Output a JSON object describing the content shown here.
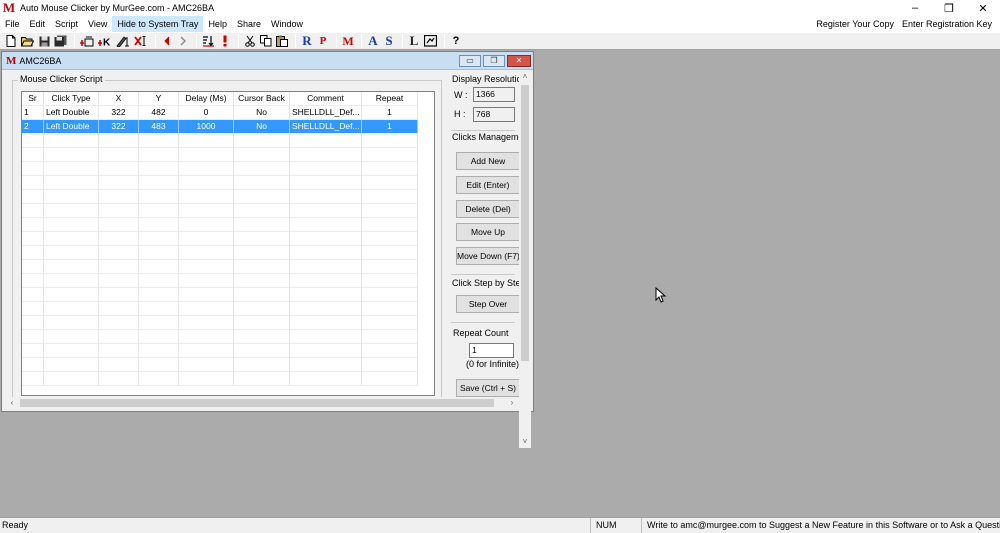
{
  "app": {
    "title": "Auto Mouse Clicker by MurGee.com - AMC26BA",
    "logo_letter": "M",
    "window_controls": [
      "–",
      "❐",
      "✕"
    ]
  },
  "menu": {
    "items": [
      "File",
      "Edit",
      "Script",
      "View",
      "Hide to System Tray",
      "Help",
      "Share",
      "Window"
    ],
    "right_items": [
      "Register Your Copy",
      "Enter Registration Key"
    ]
  },
  "toolbar": {
    "icon_names": [
      "new-file-icon",
      "open-folder-icon",
      "save-icon",
      "save-all-icon",
      "add-click-icon",
      "add-key-icon",
      "edit-icon",
      "delete-icon",
      "previous-icon",
      "next-icon",
      "sort-icon",
      "alert-icon",
      "cut-icon",
      "copy-icon",
      "paste-icon",
      "r-icon",
      "p-icon",
      "m-icon",
      "a-icon",
      "s-icon",
      "l-icon",
      "screen-icon",
      "help-icon"
    ],
    "glyphs": {
      "r": "R",
      "p": "P",
      "m": "M",
      "a": "A",
      "s": "S",
      "l": "L",
      "help": "?"
    },
    "colors": {
      "red": "#d00000",
      "blue": "#1a3ab5"
    }
  },
  "child": {
    "title": "AMC26BA",
    "logo_letter": "M",
    "controls": [
      "▭",
      "❐",
      "✕"
    ],
    "script_group_label": "Mouse Clicker Script",
    "table": {
      "columns": [
        "Sr",
        "Click Type",
        "X",
        "Y",
        "Delay (Ms)",
        "Cursor Back",
        "Comment",
        "Repeat"
      ],
      "rows": [
        [
          "1",
          "Left Double",
          "322",
          "482",
          "0",
          "No",
          "SHELLDLL_Def...",
          "1"
        ],
        [
          "2",
          "Left Double",
          "322",
          "483",
          "1000",
          "No",
          "SHELLDLL_Def...",
          "1"
        ]
      ],
      "selected_row": 1
    },
    "display_resolution": {
      "label": "Display Resolution",
      "w_label": "W :",
      "w_value": "1366",
      "h_label": "H :",
      "h_value": "768"
    },
    "clicks_management": {
      "label": "Clicks Managemen",
      "buttons": [
        "Add New",
        "Edit (Enter)",
        "Delete (Del)",
        "Move Up",
        "Move Down (F7)"
      ]
    },
    "step": {
      "label": "Click Step by Step",
      "button": "Step Over"
    },
    "repeat": {
      "label": "Repeat Count",
      "value": "1",
      "hint": "(0 for Infinite)"
    },
    "save_button": "Save (Ctrl + S)"
  },
  "status": {
    "ready": "Ready",
    "num": "NUM",
    "message": "Write to amc@murgee.com to Suggest a New Feature in this Software or to Ask a Question"
  }
}
